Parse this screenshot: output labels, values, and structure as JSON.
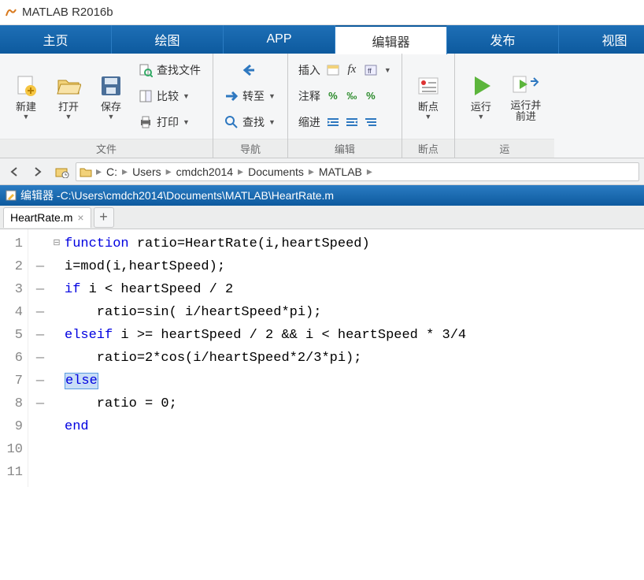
{
  "title": "MATLAB R2016b",
  "tabs": [
    {
      "label": "主页"
    },
    {
      "label": "绘图"
    },
    {
      "label": "APP"
    },
    {
      "label": "编辑器",
      "active": true
    },
    {
      "label": "发布"
    },
    {
      "label": "视图"
    }
  ],
  "toolstrip": {
    "file": {
      "label": "文件",
      "new": "新建",
      "open": "打开",
      "save": "保存",
      "findfiles": "查找文件",
      "compare": "比较",
      "print": "打印"
    },
    "nav": {
      "label": "导航",
      "goto": "转至",
      "find": "查找"
    },
    "edit": {
      "label": "编辑",
      "insert": "插入",
      "comment": "注释",
      "indent": "缩进"
    },
    "breakpoints": {
      "label": "断点",
      "breakpoints": "断点"
    },
    "run": {
      "label": "运",
      "run": "运行",
      "runadvance": "运行并\n前进"
    }
  },
  "path": {
    "segments": [
      "C:",
      "Users",
      "cmdch2014",
      "Documents",
      "MATLAB"
    ]
  },
  "editor": {
    "header_prefix": "编辑器 - ",
    "header_path": "C:\\Users\\cmdch2014\\Documents\\MATLAB\\HeartRate.m",
    "filename": "HeartRate.m"
  },
  "code": {
    "lines": [
      {
        "num": "1",
        "marker": " ",
        "fold": "⊟",
        "tokens": [
          {
            "t": "function ",
            "c": "kw"
          },
          {
            "t": "ratio=HeartRate(i,heartSpeed)"
          }
        ]
      },
      {
        "num": "2",
        "marker": "—",
        "fold": "",
        "tokens": [
          {
            "t": "i=mod(i,heartSpeed);"
          }
        ]
      },
      {
        "num": "3",
        "marker": "—",
        "fold": "",
        "tokens": [
          {
            "t": "if ",
            "c": "kw"
          },
          {
            "t": "i < heartSpeed / 2"
          }
        ]
      },
      {
        "num": "4",
        "marker": "—",
        "fold": "",
        "tokens": [
          {
            "t": "    ratio=sin( i/heartSpeed*pi);"
          }
        ]
      },
      {
        "num": "5",
        "marker": "—",
        "fold": "",
        "tokens": [
          {
            "t": "elseif ",
            "c": "kw"
          },
          {
            "t": "i >= heartSpeed / 2 && i < heartSpeed * 3/4"
          }
        ]
      },
      {
        "num": "6",
        "marker": "—",
        "fold": "",
        "tokens": [
          {
            "t": "    ratio=2*cos(i/heartSpeed*2/3*pi);"
          }
        ]
      },
      {
        "num": "7",
        "marker": "—",
        "fold": "",
        "tokens": [
          {
            "t": "else",
            "c": "kw",
            "caret": true
          }
        ]
      },
      {
        "num": "8",
        "marker": "—",
        "fold": "",
        "tokens": [
          {
            "t": "    ratio = 0;"
          }
        ]
      },
      {
        "num": "9",
        "marker": " ",
        "fold": "",
        "tokens": [
          {
            "t": "end",
            "c": "kw"
          }
        ]
      },
      {
        "num": "10",
        "marker": " ",
        "fold": "",
        "tokens": [
          {
            "t": " "
          }
        ]
      },
      {
        "num": "11",
        "marker": " ",
        "fold": "",
        "tokens": [
          {
            "t": " "
          }
        ]
      }
    ]
  }
}
